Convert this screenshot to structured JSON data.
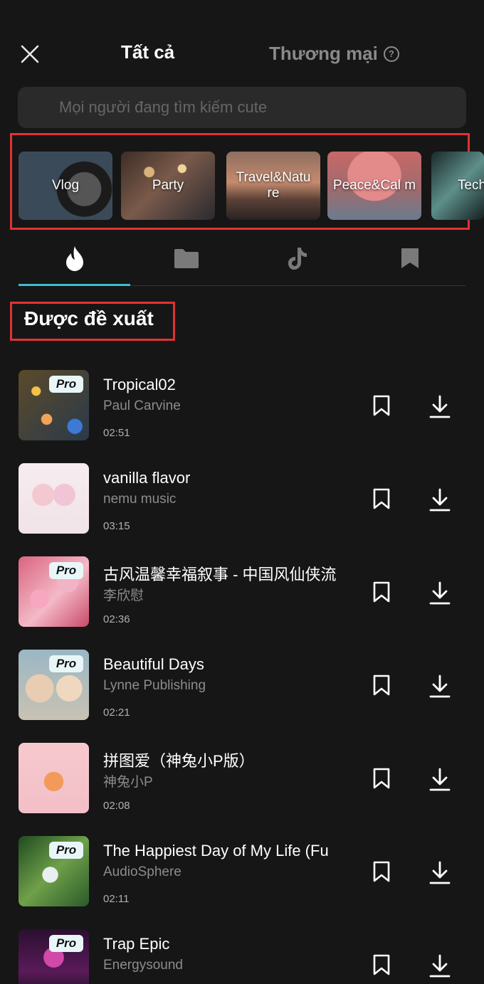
{
  "header": {
    "close_icon": "close-icon",
    "tab_all": "Tất cả",
    "tab_commercial": "Thương mại",
    "help_icon_text": "?"
  },
  "search": {
    "placeholder": "Mọi người đang tìm kiếm cute"
  },
  "categories": [
    {
      "label": "Vlog"
    },
    {
      "label": "Party"
    },
    {
      "label": "Travel&Natu re"
    },
    {
      "label": "Peace&Cal m"
    },
    {
      "label": "Tech"
    }
  ],
  "icon_tabs": [
    {
      "icon": "flame-icon",
      "active": true
    },
    {
      "icon": "folder-icon",
      "active": false
    },
    {
      "icon": "tiktok-icon",
      "active": false
    },
    {
      "icon": "bookmark-icon",
      "active": false
    }
  ],
  "section": {
    "title": "Được đề xuất"
  },
  "pro_label": "Pro",
  "tracks": [
    {
      "title": "Tropical02",
      "artist": "Paul Carvine",
      "duration": "02:51",
      "pro": true
    },
    {
      "title": "vanilla flavor",
      "artist": "nemu music",
      "duration": "03:15",
      "pro": false
    },
    {
      "title": "古风温馨幸福叙事 - 中国风仙侠流",
      "artist": "李欣慰",
      "duration": "02:36",
      "pro": true
    },
    {
      "title": "Beautiful Days",
      "artist": "Lynne Publishing",
      "duration": "02:21",
      "pro": true
    },
    {
      "title": "拼图爱（神兔小P版）",
      "artist": "神兔小P",
      "duration": "02:08",
      "pro": false
    },
    {
      "title": "The Happiest Day of My Life (Fu",
      "artist": "AudioSphere",
      "duration": "02:11",
      "pro": true
    },
    {
      "title": "Trap Epic",
      "artist": "Energysound",
      "duration": "",
      "pro": true
    }
  ],
  "colors": {
    "accent": "#3fbcd0",
    "highlight_border": "#e03333",
    "background": "#161616"
  }
}
